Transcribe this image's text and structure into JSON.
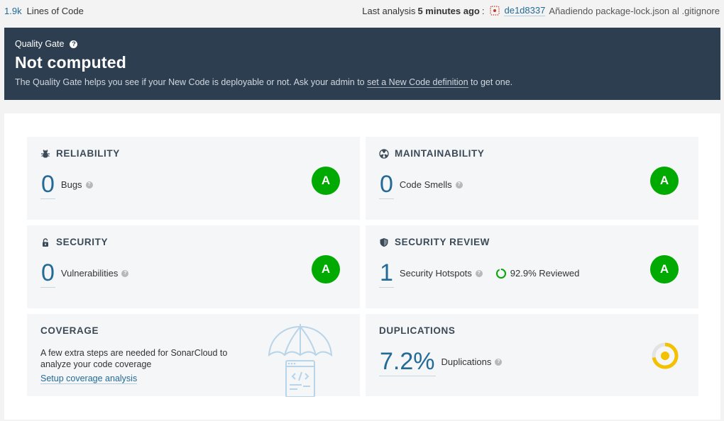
{
  "topbar": {
    "loc_value": "1.9k",
    "loc_label": "Lines of Code",
    "analysis_prefix": "Last analysis",
    "analysis_time": "5 minutes ago",
    "analysis_suffix": ":",
    "commit_hash": "de1d8337",
    "commit_message": "Añadiendo package-lock.json al .gitignore"
  },
  "quality_gate": {
    "label": "Quality Gate",
    "help_glyph": "?",
    "status": "Not computed",
    "desc_before": "The Quality Gate helps you see if your New Code is deployable or not. Ask your admin to",
    "desc_link": "set a New Code definition",
    "desc_after": "to get one."
  },
  "cards": {
    "reliability": {
      "title": "RELIABILITY",
      "value": "0",
      "label": "Bugs",
      "rating": "A",
      "icon": "bug-icon"
    },
    "maintainability": {
      "title": "MAINTAINABILITY",
      "value": "0",
      "label": "Code Smells",
      "rating": "A",
      "icon": "radiation-icon"
    },
    "security": {
      "title": "SECURITY",
      "value": "0",
      "label": "Vulnerabilities",
      "rating": "A",
      "icon": "lock-icon"
    },
    "security_review": {
      "title": "SECURITY REVIEW",
      "value": "1",
      "label": "Security Hotspots",
      "reviewed": "92.9% Reviewed",
      "reviewed_fraction": 0.929,
      "rating": "A",
      "icon": "shield-icon"
    },
    "coverage": {
      "title": "COVERAGE",
      "text": "A few extra steps are needed for SonarCloud to analyze your code coverage",
      "link": "Setup coverage analysis"
    },
    "duplications": {
      "title": "DUPLICATIONS",
      "value": "7.2%",
      "label": "Duplications",
      "fraction": 0.072
    }
  },
  "colors": {
    "accent": "#236a97",
    "header_bg": "#2d3e50",
    "rating_a": "#00aa00",
    "duplication": "#f4c100"
  }
}
